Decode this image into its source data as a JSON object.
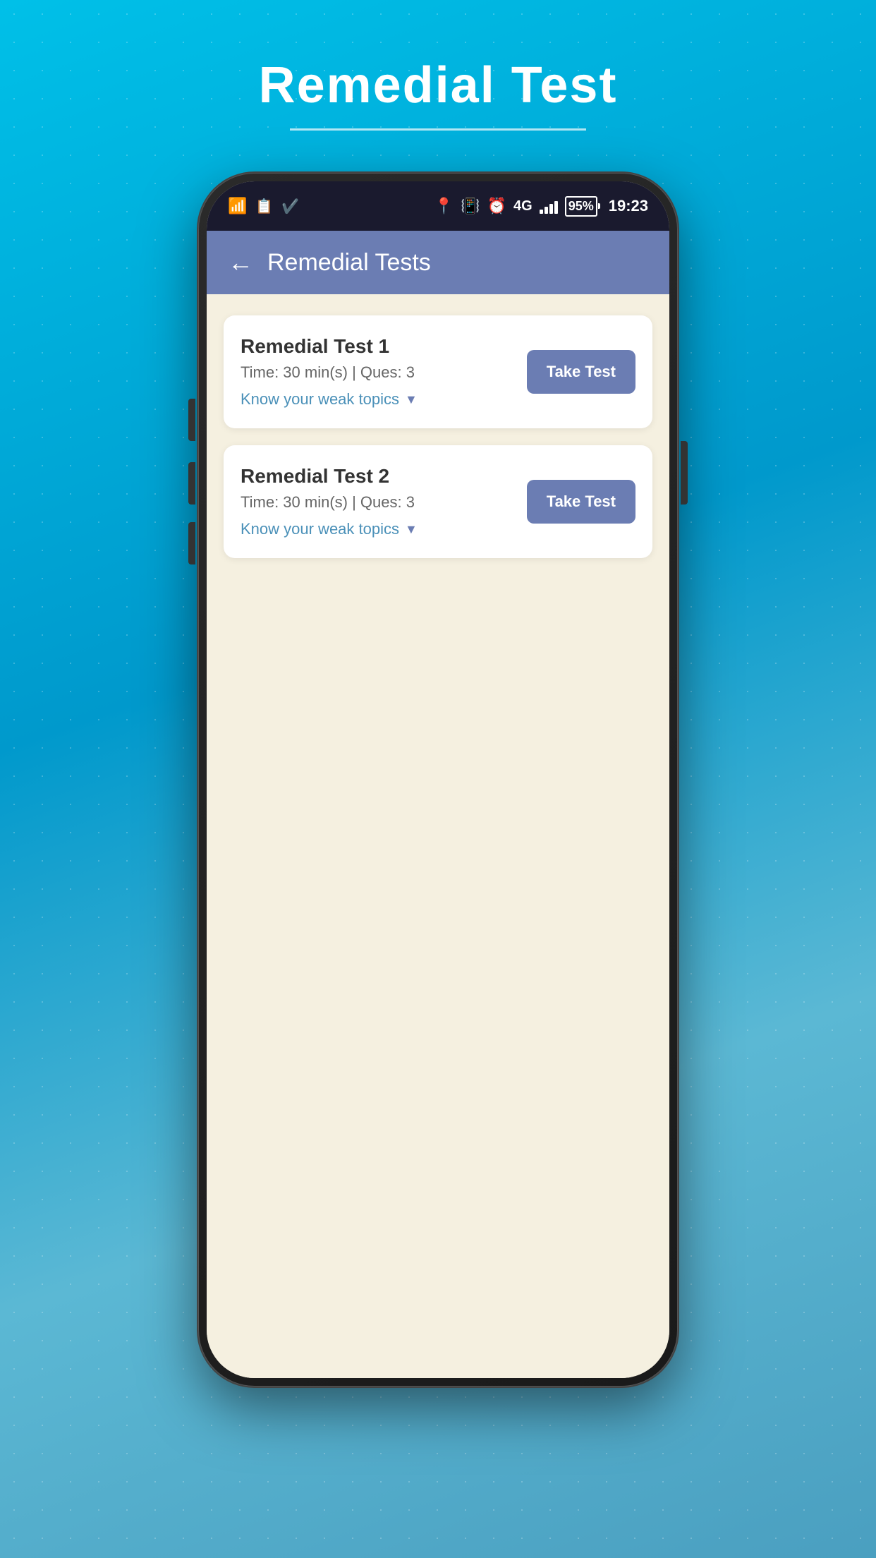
{
  "page": {
    "title": "Remedial Test",
    "title_underline": true,
    "background_color": "#00bcd4"
  },
  "status_bar": {
    "time": "19:23",
    "battery_percent": "95%",
    "network": "4G",
    "signal_bars": 4
  },
  "app_header": {
    "title": "Remedial Tests",
    "back_label": "←"
  },
  "tests": [
    {
      "id": 1,
      "title": "Remedial Test 1",
      "time": "Time: 30 min(s) | Ques: 3",
      "weak_topics_label": "Know your weak topics",
      "button_label": "Take Test"
    },
    {
      "id": 2,
      "title": "Remedial Test 2",
      "time": "Time: 30 min(s) | Ques: 3",
      "weak_topics_label": "Know your weak topics",
      "button_label": "Take Test"
    }
  ]
}
